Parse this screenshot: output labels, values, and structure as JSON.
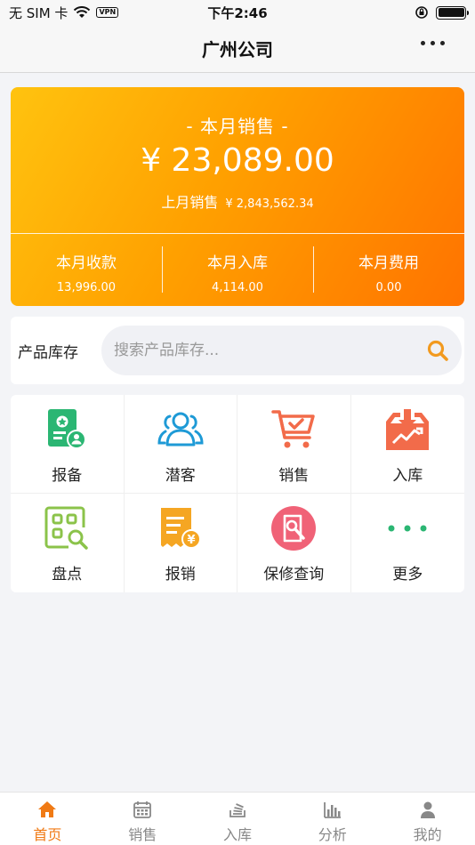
{
  "status_bar": {
    "carrier": "无 SIM 卡",
    "vpn": "VPN",
    "time": "下午2:46"
  },
  "nav": {
    "title": "广州公司"
  },
  "sales_card": {
    "label": "- 本月销售 -",
    "amount": "¥  23,089.00",
    "last_month_label": "上月销售",
    "last_month_value": "¥ 2,843,562.34",
    "stats": [
      {
        "label": "本月收款",
        "value": "13,996.00"
      },
      {
        "label": "本月入库",
        "value": "4,114.00"
      },
      {
        "label": "本月费用",
        "value": "0.00"
      }
    ],
    "gradient_colors": [
      "#ffc30f",
      "#ff7300"
    ]
  },
  "search": {
    "label": "产品库存",
    "placeholder": "搜索产品库存...",
    "icon": "search-icon"
  },
  "grid": {
    "items": [
      {
        "label": "报备",
        "icon": "report-icon",
        "color": "#2bb673"
      },
      {
        "label": "潜客",
        "icon": "users-icon",
        "color": "#1e9ad6"
      },
      {
        "label": "销售",
        "icon": "cart-icon",
        "color": "#f26b4a"
      },
      {
        "label": "入库",
        "icon": "inbound-icon",
        "color": "#f26b4a"
      },
      {
        "label": "盘点",
        "icon": "inventory-icon",
        "color": "#8bc34a"
      },
      {
        "label": "报销",
        "icon": "expense-icon",
        "color": "#f5a623"
      },
      {
        "label": "保修查询",
        "icon": "warranty-icon",
        "color": "#f06277"
      },
      {
        "label": "更多",
        "icon": "more-icon",
        "color": "#2bb673"
      }
    ]
  },
  "tab_bar": {
    "active_color": "#f07a14",
    "tabs": [
      {
        "label": "首页",
        "icon": "home-icon",
        "active": true
      },
      {
        "label": "销售",
        "icon": "calendar-icon",
        "active": false
      },
      {
        "label": "入库",
        "icon": "stack-icon",
        "active": false
      },
      {
        "label": "分析",
        "icon": "bar-chart-icon",
        "active": false
      },
      {
        "label": "我的",
        "icon": "user-icon",
        "active": false
      }
    ]
  }
}
